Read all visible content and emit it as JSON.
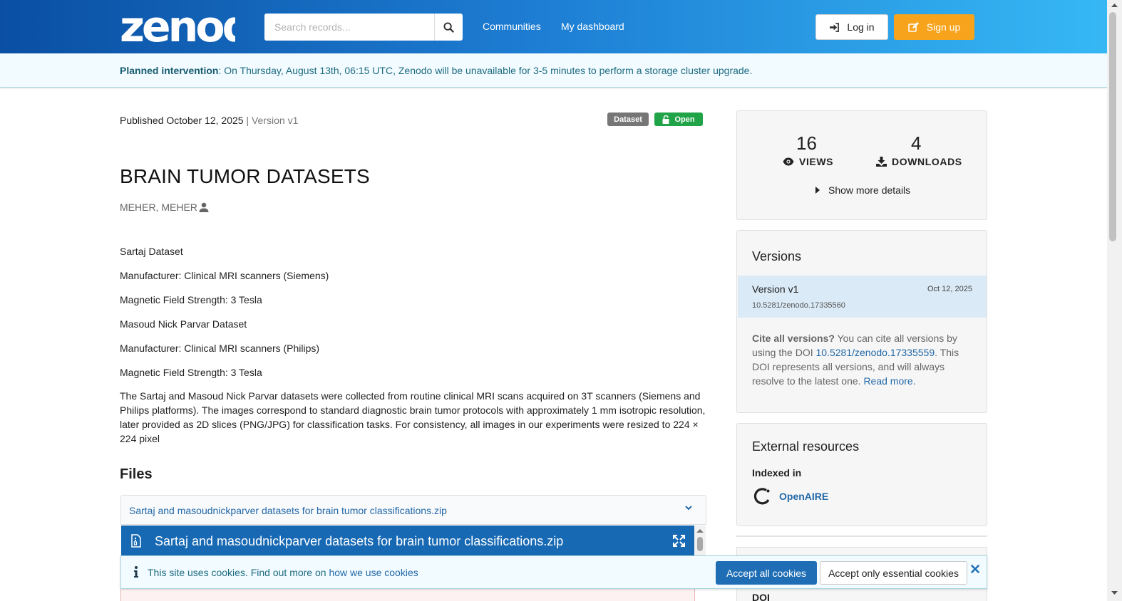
{
  "header": {
    "logo_text": "zenodo",
    "search_placeholder": "Search records...",
    "nav": [
      "Communities",
      "My dashboard"
    ],
    "login_label": "Log in",
    "signup_label": "Sign up"
  },
  "banner": {
    "strong": "Planned intervention",
    "text": ": On Thursday, August 13th, 06:15 UTC, Zenodo will be unavailable for 3-5 minutes to perform a storage cluster upgrade."
  },
  "record": {
    "published": "Published October 12, 2025",
    "version": " | Version v1",
    "badge_type": "Dataset",
    "badge_access": "Open",
    "title": "BRAIN TUMOR DATASETS",
    "creator": "MEHER, MEHER",
    "description_lines": [
      "Sartaj Dataset",
      "Manufacturer: Clinical MRI scanners (Siemens)",
      "Magnetic Field Strength: 3 Tesla",
      "Masoud Nick Parvar Dataset",
      "Manufacturer: Clinical MRI scanners (Philips)",
      "Magnetic Field Strength: 3 Tesla"
    ],
    "description_paragraph": "The Sartaj and Masoud Nick Parvar datasets were collected from routine clinical MRI scans acquired on 3T scanners (Siemens and Philips platforms). The images correspond to standard diagnostic brain tumor protocols with approximately 1 mm isotropic resolution, later provided as 2D slices (PNG/JPG) for classification tasks. For consistency, all images in our experiments were resized to 224 × 224 pixel"
  },
  "files": {
    "heading": "Files",
    "accordion_title": "Sartaj and masoudnickparver datasets for brain tumor classifications.zip",
    "preview_title": "Sartaj and masoudnickparver datasets for brain tumor classifications.zip"
  },
  "stats": {
    "views": "16",
    "views_label": "VIEWS",
    "downloads": "4",
    "downloads_label": "DOWNLOADS",
    "more_label": "Show more details"
  },
  "versions": {
    "heading": "Versions",
    "current_name": "Version v1",
    "current_date": "Oct 12, 2025",
    "current_doi": "10.5281/zenodo.17335560",
    "cite_strong": "Cite all versions?",
    "cite_text_1": " You can cite all versions by using the DOI ",
    "cite_doi": "10.5281/zenodo.17335559",
    "cite_text_2": ". This DOI represents all versions, and will always resolve to the latest one. ",
    "read_more": "Read more."
  },
  "external": {
    "heading": "External resources",
    "indexed_label": "Indexed in",
    "openaire": "OpenAIRE"
  },
  "details": {
    "doi_label": "DOI"
  },
  "cookie": {
    "text": "This site uses cookies. Find out more on ",
    "link": "how we use cookies",
    "accept_all": "Accept all cookies",
    "accept_essential": "Accept only essential cookies"
  },
  "colors": {
    "header_start": "#0a4fa3",
    "header_end": "#36b8f5",
    "signup": "#f7a31c",
    "open_badge": "#21a348",
    "link": "#2469a8",
    "preview_bar": "#1769b4"
  },
  "icons": [
    "search-icon",
    "sign-in-icon",
    "edit-icon",
    "lock-open-icon",
    "user-icon",
    "eye-icon",
    "download-icon",
    "caret-right-icon",
    "chevron-down-icon",
    "file-archive-icon",
    "expand-icon",
    "info-icon",
    "close-icon",
    "openaire-icon"
  ]
}
